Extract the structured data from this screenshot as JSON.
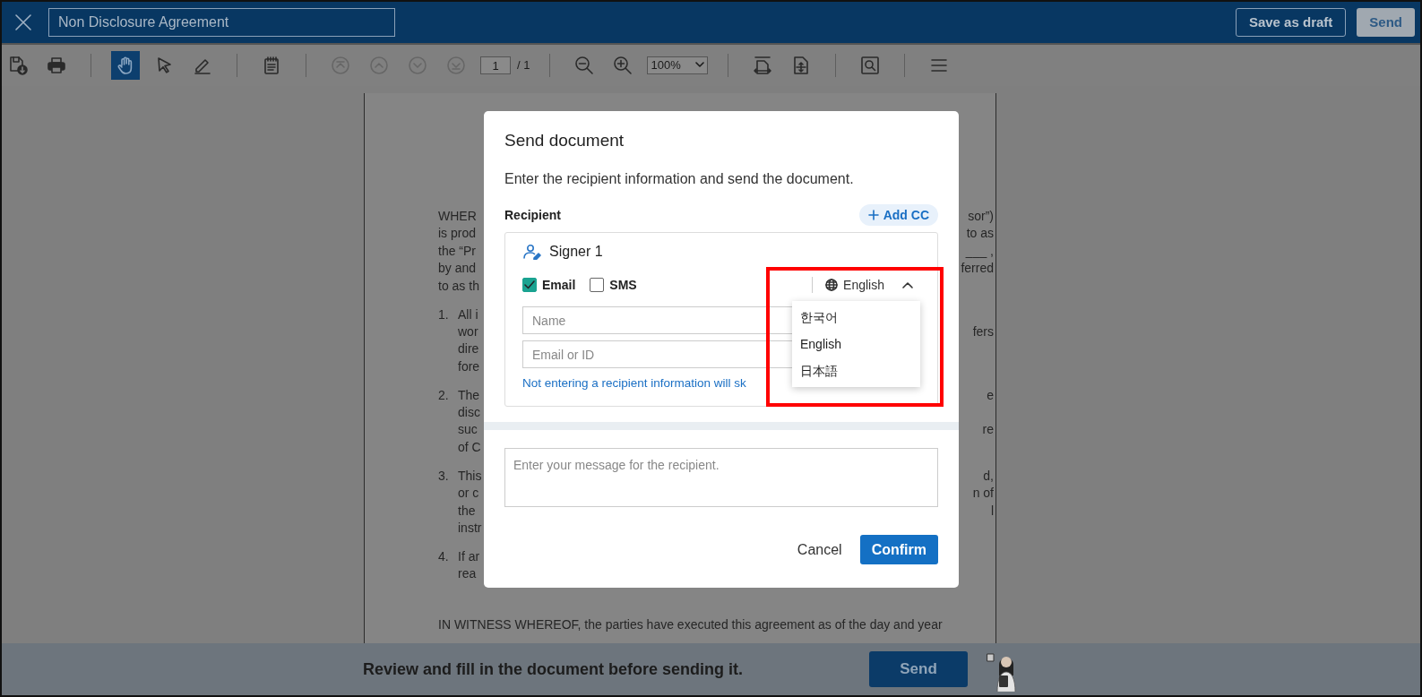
{
  "header": {
    "title_value": "Non Disclosure Agreement",
    "buttons": [
      {
        "label": "Save as draft",
        "kind": "outline"
      },
      {
        "label": "Send",
        "kind": "filled"
      }
    ]
  },
  "toolbar": [
    {
      "kind": "button",
      "selected": false,
      "disabled": false
    },
    {
      "kind": "button",
      "selected": false,
      "disabled": false
    },
    {
      "kind": "separator"
    },
    {
      "kind": "button",
      "selected": true,
      "disabled": false
    },
    {
      "kind": "button",
      "selected": false,
      "disabled": false
    },
    {
      "kind": "button",
      "selected": false,
      "disabled": false
    },
    {
      "kind": "separator"
    },
    {
      "kind": "button",
      "selected": false,
      "disabled": false
    },
    {
      "kind": "separator"
    },
    {
      "kind": "button",
      "selected": false,
      "disabled": true
    },
    {
      "kind": "button",
      "selected": false,
      "disabled": true
    },
    {
      "kind": "button",
      "selected": false,
      "disabled": true
    },
    {
      "kind": "button",
      "selected": false,
      "disabled": true
    },
    {
      "kind": "page_field",
      "value": "1",
      "total": "/ 1"
    },
    {
      "kind": "separator"
    },
    {
      "kind": "button",
      "selected": false,
      "disabled": false
    },
    {
      "kind": "button",
      "selected": false,
      "disabled": false
    },
    {
      "kind": "zoom_select",
      "value": "100%"
    },
    {
      "kind": "separator"
    },
    {
      "kind": "button",
      "selected": false,
      "disabled": false
    },
    {
      "kind": "button",
      "selected": false,
      "disabled": false
    },
    {
      "kind": "separator"
    },
    {
      "kind": "button",
      "selected": false,
      "disabled": false
    },
    {
      "kind": "separator"
    },
    {
      "kind": "button",
      "selected": false,
      "disabled": false
    }
  ],
  "document": {
    "paragraphs": [
      {
        "kind": "partial",
        "lines": [
          {
            "left": "WHER",
            "right": "sor”)"
          },
          {
            "left": "is prod",
            "right": "to as"
          },
          {
            "left": "the “Pr",
            "right": "___ ,"
          },
          {
            "left": "by and",
            "right": "ferred"
          },
          {
            "left": "to as th"
          }
        ]
      },
      {
        "kind": "partial",
        "number": "1.",
        "lines": [
          {
            "left": "All i"
          },
          {
            "left": "wor",
            "right": "fers"
          },
          {
            "left": "dire"
          },
          {
            "left": "fore"
          }
        ]
      },
      {
        "kind": "partial",
        "number": "2.",
        "lines": [
          {
            "left": "The",
            "right": "e"
          },
          {
            "left": "disc"
          },
          {
            "left": "suc",
            "right": "re"
          },
          {
            "left": "of C"
          }
        ]
      },
      {
        "kind": "partial",
        "number": "3.",
        "lines": [
          {
            "left": "This",
            "right": "d,"
          },
          {
            "left": "or c",
            "right": "n of"
          },
          {
            "left": "the",
            "right": "l"
          },
          {
            "left": "instr"
          }
        ]
      },
      {
        "kind": "partial",
        "number": "4.",
        "lines": [
          {
            "left": "If ar"
          },
          {
            "left": "rea"
          }
        ]
      },
      {
        "kind": "full",
        "lines": [
          {
            "left": "IN WITNESS WHEREOF, the parties have executed this agreement as of the day and year"
          }
        ]
      }
    ]
  },
  "dialog": {
    "title": "Send document",
    "subtitle": "Enter the recipient information and send the document.",
    "recipient_label": "Recipient",
    "add_cc": "Add CC",
    "signer": {
      "title": "Signer 1",
      "channels": [
        {
          "label": "Email",
          "checked": true
        },
        {
          "label": "SMS",
          "checked": false
        }
      ],
      "language": {
        "value": "English",
        "expanded": true,
        "options": [
          "한국어",
          "English",
          "日本語"
        ]
      },
      "name_placeholder": "Name",
      "email_placeholder": "Email or ID",
      "hint": "Not entering a recipient information will sk"
    },
    "message_placeholder": "Enter your message for the recipient.",
    "buttons": [
      {
        "label": "Cancel",
        "kind": "text"
      },
      {
        "label": "Confirm",
        "kind": "primary"
      }
    ],
    "highlight_language_menu": true
  },
  "footer": {
    "message": "Review and fill in the document before sending it.",
    "button": "Send"
  }
}
